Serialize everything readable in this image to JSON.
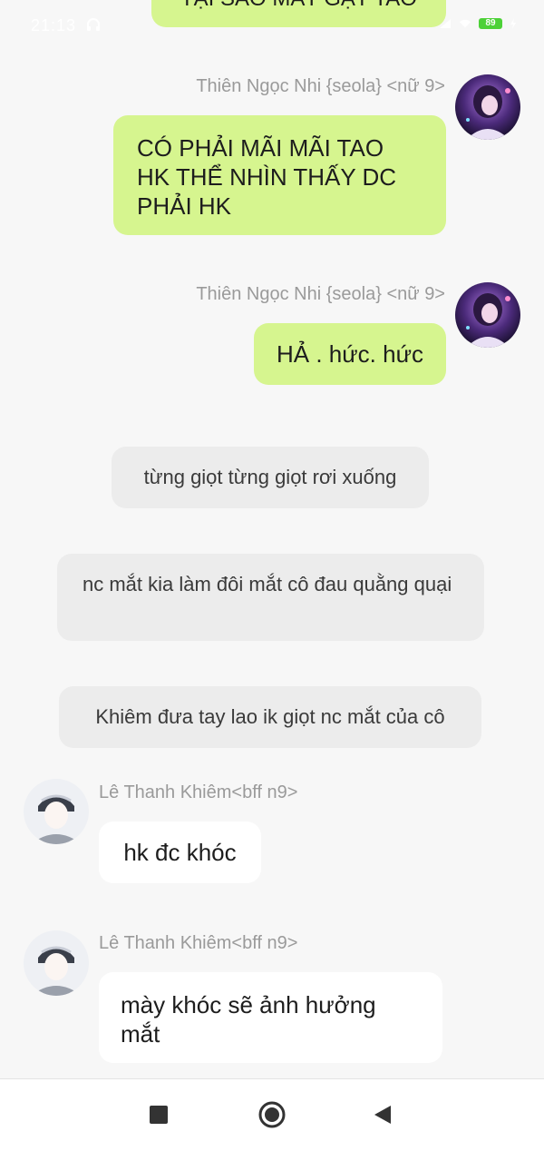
{
  "status_bar": {
    "time": "21:13",
    "battery": "89"
  },
  "messages": [
    {
      "type": "outgoing",
      "text": "TẠI SAO MẤT GẶT TAO"
    },
    {
      "type": "outgoing",
      "sender": "Thiên Ngọc Nhi {seola} <nữ 9>",
      "text": "CÓ PHẢI MÃI MÃI TAO HK THỂ NHÌN THẤY DC PHẢI HK"
    },
    {
      "type": "outgoing",
      "sender": "Thiên Ngọc Nhi {seola} <nữ 9>",
      "text": "HẢ . hức. hức"
    },
    {
      "type": "narration",
      "text": "từng giọt từng giọt rơi xuống"
    },
    {
      "type": "narration",
      "text": "nc mắt kia làm đôi mắt cô đau quằng quại"
    },
    {
      "type": "narration",
      "text": "Khiêm đưa tay lao ik giọt nc mắt của cô"
    },
    {
      "type": "incoming",
      "sender": "Lê Thanh Khiêm<bff n9>",
      "text": "hk đc khóc"
    },
    {
      "type": "incoming",
      "sender": "Lê Thanh Khiêm<bff n9>",
      "text": "mày khóc sẽ ảnh hưởng mắt"
    }
  ],
  "nav": {
    "recents": "square-icon",
    "home": "circle-icon",
    "back": "triangle-back-icon"
  }
}
